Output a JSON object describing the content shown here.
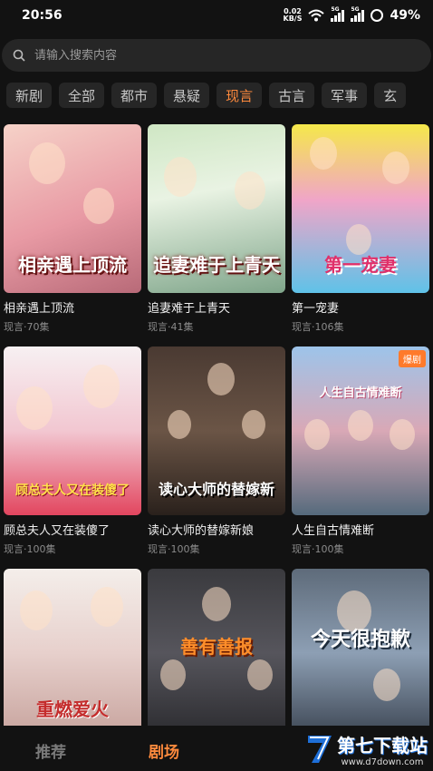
{
  "status": {
    "time": "20:56",
    "net_speed_value": "0.02",
    "net_speed_unit": "KB/S",
    "sim1_tag": "5G",
    "sim2_tag": "5G",
    "battery": "49%"
  },
  "search": {
    "placeholder": "请输入搜索内容"
  },
  "tabs": [
    {
      "label": "新剧"
    },
    {
      "label": "全部"
    },
    {
      "label": "都市"
    },
    {
      "label": "悬疑"
    },
    {
      "label": "现言"
    },
    {
      "label": "古言"
    },
    {
      "label": "军事"
    },
    {
      "label": "玄"
    }
  ],
  "active_tab": "现言",
  "cards": [
    {
      "title": "相亲遇上顶流",
      "meta": "现言·70集",
      "poster_text": "相亲遇上顶流",
      "badge": ""
    },
    {
      "title": "追妻难于上青天",
      "meta": "现言·41集",
      "poster_text": "追妻难于上青天",
      "badge": ""
    },
    {
      "title": "第一宠妻",
      "meta": "现言·106集",
      "poster_text": "第一宠妻",
      "badge": ""
    },
    {
      "title": "顾总夫人又在装傻了",
      "meta": "现言·100集",
      "poster_text": "顾总夫人又在装傻了",
      "badge": ""
    },
    {
      "title": "读心大师的替嫁新娘",
      "meta": "现言·100集",
      "poster_text": "读心大师的替嫁新",
      "badge": ""
    },
    {
      "title": "人生自古情难断",
      "meta": "现言·100集",
      "poster_text": "人生自古情难断",
      "badge": "爆剧"
    },
    {
      "title": "",
      "meta": "",
      "poster_text": "重燃爱火",
      "badge": ""
    },
    {
      "title": "",
      "meta": "",
      "poster_text": "善有善报",
      "badge": ""
    },
    {
      "title": "",
      "meta": "",
      "poster_text": "今天很抱歉",
      "badge": ""
    }
  ],
  "nav": {
    "recommend": "推荐",
    "theater": "剧场"
  },
  "watermark": {
    "main": "第七下载站",
    "url": "www.d7down.com"
  },
  "colors": {
    "accent": "#ff8a3d",
    "background": "#121212",
    "chip_bg": "#262626"
  }
}
